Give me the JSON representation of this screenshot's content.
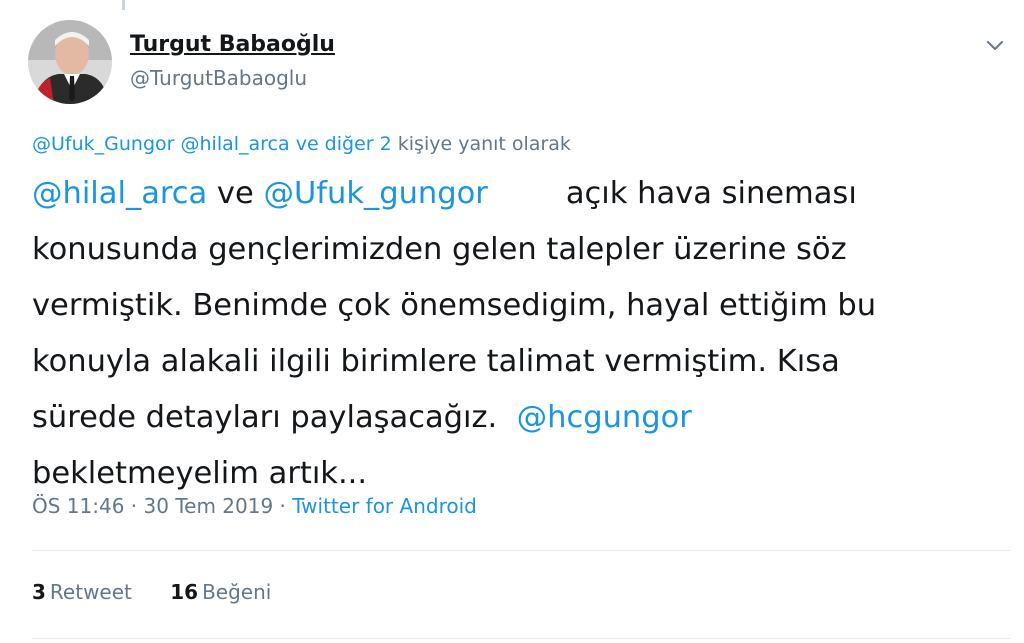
{
  "tweet": {
    "author": {
      "name": "Turgut Babaoğlu",
      "handle": "@TurgutBabaoglu"
    },
    "reply_to": {
      "mention1": "@Ufuk_Gungor",
      "mention2": "@hilal_arca",
      "others": "ve diğer 2",
      "suffix": "kişiye yanıt olarak"
    },
    "text": {
      "mention_hilal": "@hilal_arca",
      "and_word": " ve ",
      "mention_ufuk": "@Ufuk_gungor",
      "line1_rest": "açık hava sineması",
      "line2": "konusunda gençlerimizden gelen talepler üzerine söz",
      "line3": "vermiştik. Benimde çok önemsedigim, hayal ettiğim bu",
      "line4": "konuyla alakali ilgili birimlere talimat vermiştim. Kısa",
      "line5": "sürede detayları paylaşacağız.",
      "mention_hc": "@hcgungor",
      "line6": "bekletmeyelim artık..."
    },
    "meta": {
      "time": "ÖS 11:46",
      "separator1": " · ",
      "date": "30 Tem 2019",
      "separator2": " · ",
      "source": "Twitter for Android"
    },
    "stats": {
      "retweet_count": "3",
      "retweet_label": "Retweet",
      "like_count": "16",
      "like_label": "Beğeni"
    }
  },
  "icons": {
    "menu": "chevron-down-icon",
    "avatar": "profile-photo"
  },
  "colors": {
    "link": "#1b95e0",
    "muted": "#657786",
    "text": "#14171a",
    "divider": "#e6ecf0"
  }
}
